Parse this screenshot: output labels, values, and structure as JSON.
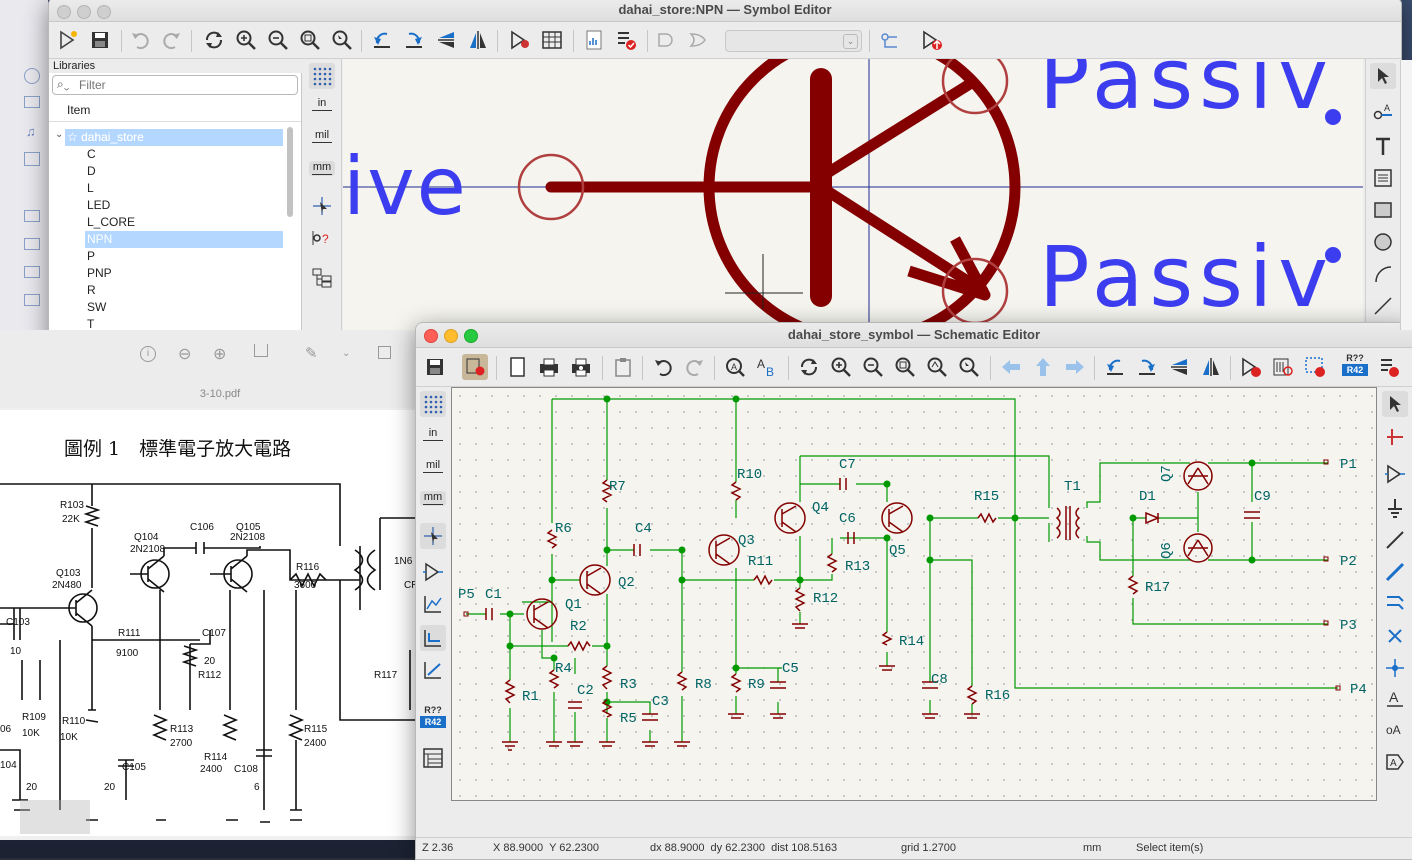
{
  "symbol_editor": {
    "title": "dahai_store:NPN — Symbol Editor",
    "libraries_header": "Libraries",
    "filter_placeholder": "Filter",
    "column_item": "Item",
    "tree_root": "☆ dahai_store",
    "tree_items": [
      "C",
      "D",
      "L",
      "LED",
      "L_CORE",
      "NPN",
      "P",
      "PNP",
      "R",
      "SW",
      "T"
    ],
    "selected_item": "NPN",
    "units": {
      "in": "in",
      "mil": "mil",
      "mm": "mm"
    },
    "canvas_text": {
      "ive": "ive",
      "passive1": "Passiv",
      "passive2": "Passiv"
    }
  },
  "pdf_viewer": {
    "filename": "3-10.pdf",
    "heading": "圖例 1　標準電子放大電路",
    "labels": [
      "R103",
      "22K",
      "Q104",
      "2N2108",
      "C106",
      "Q105",
      "2N2108",
      "R116",
      "3600",
      "Q103",
      "2N480",
      "C103",
      "10",
      "R111",
      "9100",
      "C107",
      "20",
      "R112",
      "R109",
      "10K",
      "R110",
      "10K",
      "R113",
      "2700",
      "R114",
      "2400",
      "C105",
      "20",
      "C108",
      "6",
      "R115",
      "2400",
      "R117",
      "1N6",
      "CR",
      "06",
      "104",
      "20"
    ]
  },
  "schematic_editor": {
    "title": "dahai_store_symbol — Schematic Editor",
    "units": {
      "in": "in",
      "mil": "mil",
      "mm": "mm"
    },
    "refdes_badge": {
      "top": "R??",
      "bottom": "R42"
    },
    "labels": [
      "P5",
      "C1",
      "Q1",
      "R2",
      "R4",
      "R1",
      "C2",
      "R3",
      "R5",
      "C3",
      "R6",
      "R7",
      "Q2",
      "C4",
      "Q3",
      "R8",
      "R10",
      "R11",
      "R12",
      "C5",
      "R9",
      "C7",
      "C6",
      "Q4",
      "R13",
      "Q5",
      "R14",
      "C8",
      "R15",
      "R16",
      "T1",
      "D1",
      "R17",
      "Q7",
      "Q6",
      "C9",
      "P1",
      "P2",
      "P3",
      "P4"
    ],
    "status": {
      "zoom": "Z 2.36",
      "xy": "X 88.9000  Y 62.2300",
      "delta": "dx 88.9000  dy 62.2300  dist 108.5163",
      "grid": "grid 1.2700",
      "unit": "mm",
      "mode": "Select item(s)"
    }
  },
  "colors": {
    "wire": "#009900",
    "symbol": "#840000",
    "text": "#006464",
    "pin_text": "#3d3df0"
  }
}
